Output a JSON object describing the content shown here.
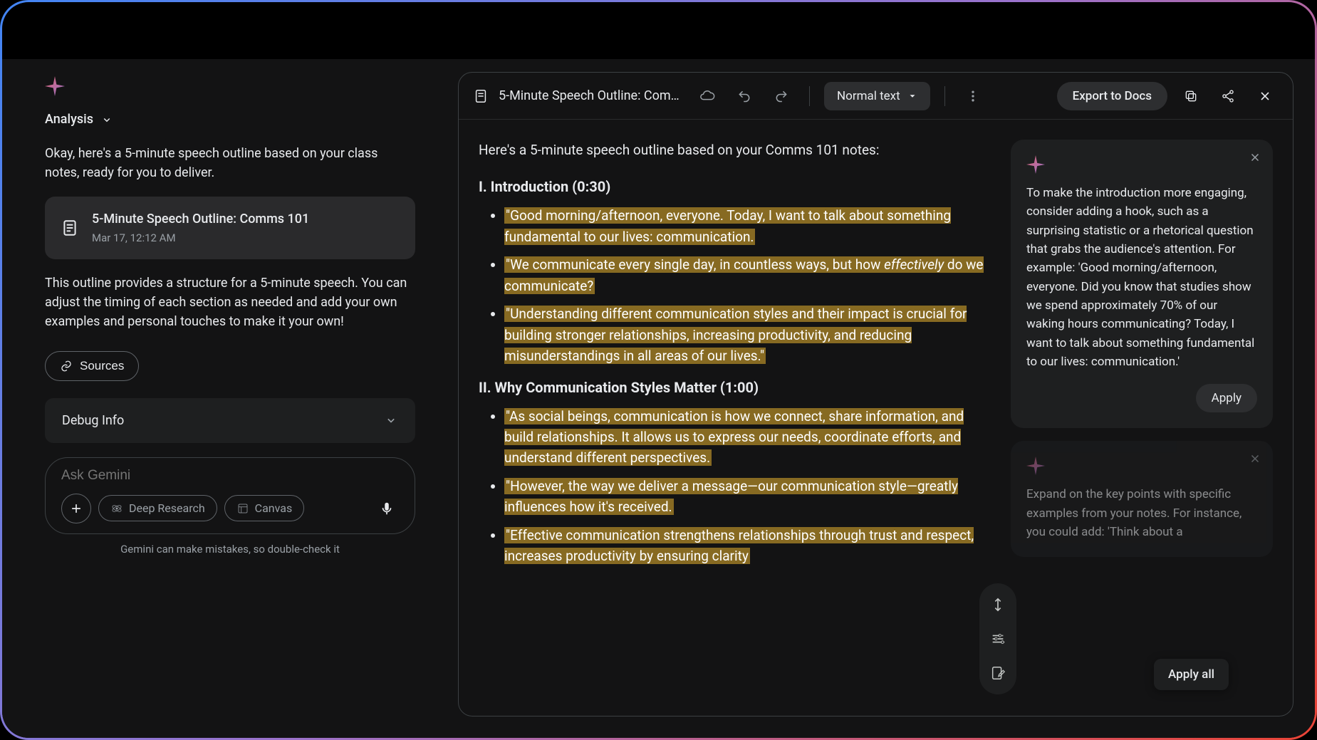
{
  "left": {
    "analysis_label": "Analysis",
    "intro": "Okay, here's a 5-minute speech outline based on your class notes, ready for you to deliver.",
    "doc_card": {
      "title": "5-Minute Speech Outline: Comms 101",
      "meta": "Mar 17, 12:12 AM"
    },
    "desc": "This outline provides a structure for a 5-minute speech.  You can adjust the timing of each section as needed and add your own examples and personal touches to make it your own!",
    "sources_label": "Sources",
    "debug_label": "Debug Info",
    "prompt_placeholder": "Ask Gemini",
    "chip_deep": "Deep Research",
    "chip_canvas": "Canvas",
    "disclaimer": "Gemini can make mistakes, so double-check it"
  },
  "toolbar": {
    "title": "5-Minute Speech Outline: Comm…",
    "normal_text": "Normal text",
    "export": "Export to Docs"
  },
  "doc": {
    "intro": "Here's a 5-minute speech outline based on your Comms 101 notes:",
    "h1": "I. Introduction (0:30)",
    "s1": {
      "b1": "\"Good morning/afternoon, everyone. Today, I want to talk about something fundamental to our lives: communication.",
      "b2_pre": "\"We communicate every single day, in countless ways, but how ",
      "b2_em": "effectively",
      "b2_post": " do we communicate?",
      "b3": "\"Understanding different communication styles and their impact is crucial for building stronger relationships, increasing productivity, and reducing misunderstandings in all areas of our lives.\""
    },
    "h2": "II. Why Communication Styles Matter (1:00)",
    "s2": {
      "b1": "\"As social beings, communication is how we connect, share information, and build relationships. It allows us to express our needs, coordinate efforts, and understand different perspectives.",
      "b2": "\"However, the way we deliver a message—our communication style—greatly influences how it's received.",
      "b3": "\"Effective communication strengthens relationships through trust and respect, increases productivity by ensuring clarity"
    }
  },
  "sugg": {
    "card1": "To make the introduction more engaging, consider adding a hook, such as a surprising statistic or a rhetorical question that grabs the audience's attention. For example: 'Good morning/afternoon, everyone. Did you know that studies show we spend approximately 70% of our waking hours communicating? Today, I want to talk about something fundamental to our lives: communication.'",
    "apply": "Apply",
    "card2": "Expand on the key points with specific examples from your notes. For instance, you could add: 'Think about a",
    "apply_all": "Apply all"
  }
}
